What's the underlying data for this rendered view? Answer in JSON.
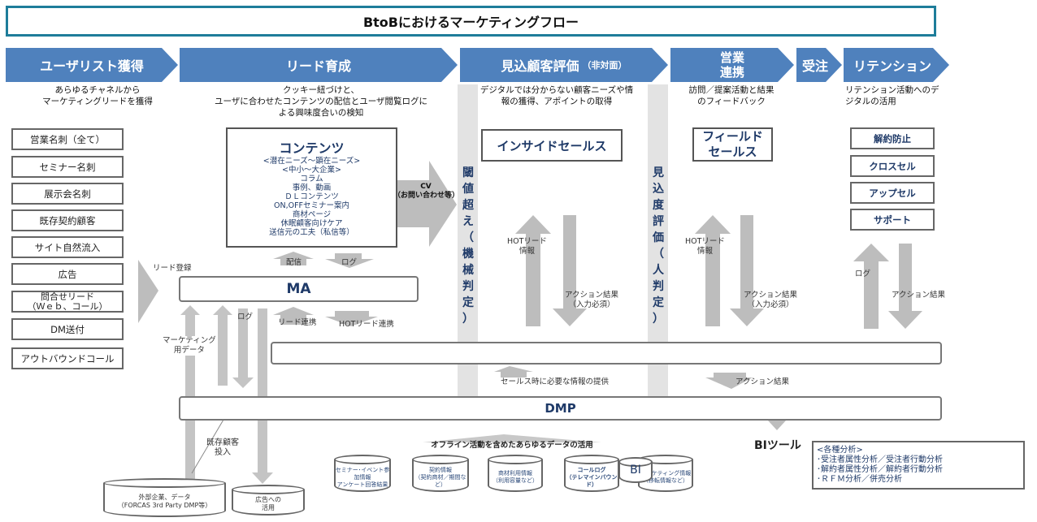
{
  "title": "BtoBにおけるマーケティングフロー",
  "phases": [
    {
      "label": "ユーザリスト獲得",
      "sub": "",
      "desc": [
        "あらゆるチャネルから",
        "マーケティングリードを獲得"
      ]
    },
    {
      "label": "リード育成",
      "sub": "",
      "desc": [
        "クッキー紐づけと、",
        "ユーザに合わせたコンテンツの配信とユーザ閲覧ログに",
        "よる興味度合いの検知"
      ]
    },
    {
      "label": "見込顧客評価",
      "sub": "（非対面）",
      "desc": [
        "デジタルでは分からない顧客ニーズや情",
        "報の獲得、アポイントの取得"
      ]
    },
    {
      "label": "営業",
      "label2": "連携",
      "desc": [
        "訪問／提案活動と結果",
        "のフィードバック"
      ]
    },
    {
      "label": "受注"
    },
    {
      "label": "リテンション",
      "desc": [
        "リテンション活動へのデ",
        "ジタルの活用"
      ]
    }
  ],
  "sources": [
    "営業名刺（全て）",
    "セミナー名刺",
    "展示会名刺",
    "既存契約顧客",
    "サイト自然流入",
    "広告",
    "問合せリード",
    "（Ｗｅｂ、コール）",
    "DM送付",
    "アウトバウンドコール"
  ],
  "contents": {
    "title": "コンテンツ",
    "lines": [
      "<潜在ニーズ～顕在ニーズ>",
      "<中小～大企業>",
      "コラム",
      "事例、動画",
      "ＤＬコンテンツ",
      "ON,OFFセミナー案内",
      "商材ページ",
      "休眠顧客向けケア",
      "送信元の工夫（私信等）"
    ]
  },
  "cv_arrow": [
    "CV",
    "（お問い合わせ等）"
  ],
  "threshold_label": [
    "閾",
    "値",
    "超",
    "え",
    "（",
    "機",
    "械",
    "判",
    "定",
    "）"
  ],
  "prospect_label": [
    "見",
    "込",
    "度",
    "評",
    "価",
    "（",
    "人",
    "判",
    "定",
    "）"
  ],
  "inside_sales": "インサイドセールス",
  "field_sales": [
    "フィールド",
    "セールス"
  ],
  "retention_items": [
    "解約防止",
    "クロスセル",
    "アップセル",
    "サポート"
  ],
  "ma": {
    "label": "MA",
    "lead_register": "リード登録",
    "deliver": "配信",
    "log": "ログ",
    "log2": "ログ",
    "lead_link": "リード連携",
    "hot_lead_link": "HOTリード連携",
    "marketing_data": [
      "マーケティング",
      "用データ"
    ]
  },
  "flow_labels": {
    "hot_lead_info": [
      "HOTリード",
      "情報"
    ],
    "action_result_required": [
      "アクション結果",
      "（入力必須）"
    ],
    "action_result": "アクション結果",
    "retention_log": "ログ",
    "sales_info": "セールス時に必要な情報の提供",
    "dmp_action_result": "アクション結果"
  },
  "dmp": {
    "label": "DMP"
  },
  "bi_tool": "BIツール",
  "analysis": [
    "<各種分析>",
    "･受注者属性分析／受注者行動分析",
    "･解約者属性分析／解約者行動分析",
    "･ＲＦＭ分析／併売分析"
  ],
  "offline_label": "オフライン活動を含めたあらゆるデータの活用",
  "existing_customer": [
    "既存顧客",
    "投入"
  ],
  "external_data": [
    "外部企業、データ",
    "（FORCAS 3rd Party DMP等）"
  ],
  "ad_use": [
    "広告への",
    "活用"
  ],
  "data_stores": [
    [
      "セミナー･イベント参加情報",
      "アンケート回答結果"
    ],
    [
      "契約情報",
      "（契約商材／期間など）"
    ],
    [
      "商材利用情報",
      "（利用容量など）"
    ],
    [
      "コールログ",
      "（テレマインバウンド）"
    ],
    [
      "マーケティング情報",
      "（移転情報など）"
    ]
  ],
  "bi_small": "BI",
  "colors": {
    "phase": "#4f81bd",
    "title_border": "#1e7d9a",
    "accent_text": "#1f3a68",
    "arrow": "#bdbdbd"
  }
}
